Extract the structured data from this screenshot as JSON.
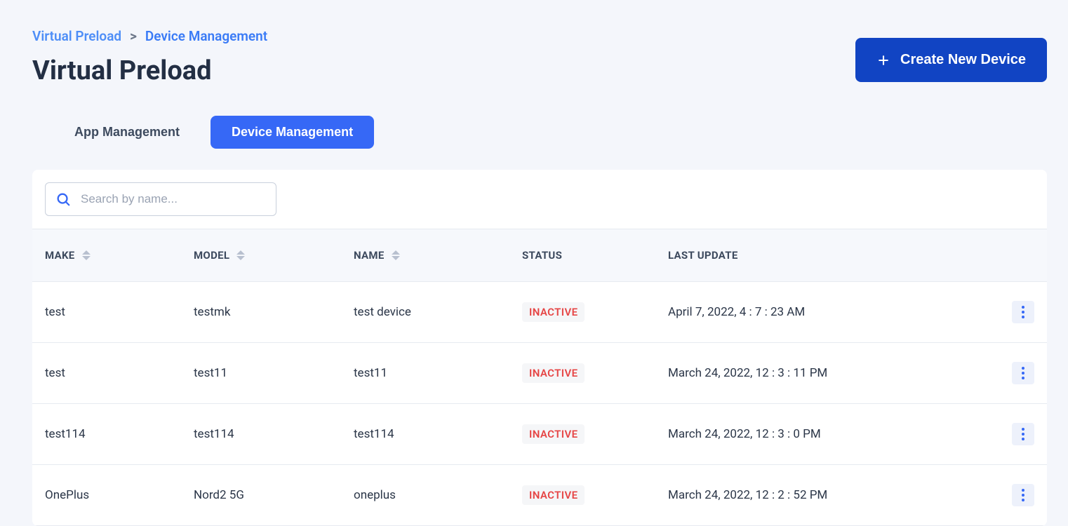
{
  "breadcrumb": {
    "root": "Virtual Preload",
    "current": "Device Management"
  },
  "page_title": "Virtual Preload",
  "create_button_label": "Create New Device",
  "tabs": [
    {
      "label": "App Management",
      "active": false
    },
    {
      "label": "Device Management",
      "active": true
    }
  ],
  "search": {
    "placeholder": "Search by name..."
  },
  "table": {
    "columns": [
      {
        "label": "MAKE",
        "sortable": true
      },
      {
        "label": "MODEL",
        "sortable": true
      },
      {
        "label": "NAME",
        "sortable": true
      },
      {
        "label": "STATUS",
        "sortable": false
      },
      {
        "label": "LAST UPDATE",
        "sortable": false
      }
    ],
    "rows": [
      {
        "make": "test",
        "model": "testmk",
        "name": "test device",
        "status": "INACTIVE",
        "last_update": "April 7, 2022, 4 : 7 : 23 AM"
      },
      {
        "make": "test",
        "model": "test11",
        "name": "test11",
        "status": "INACTIVE",
        "last_update": "March 24, 2022, 12 : 3 : 11 PM"
      },
      {
        "make": "test114",
        "model": "test114",
        "name": "test114",
        "status": "INACTIVE",
        "last_update": "March 24, 2022, 12 : 3 : 0 PM"
      },
      {
        "make": "OnePlus",
        "model": "Nord2 5G",
        "name": "oneplus",
        "status": "INACTIVE",
        "last_update": "March 24, 2022, 12 : 2 : 52 PM"
      }
    ]
  }
}
